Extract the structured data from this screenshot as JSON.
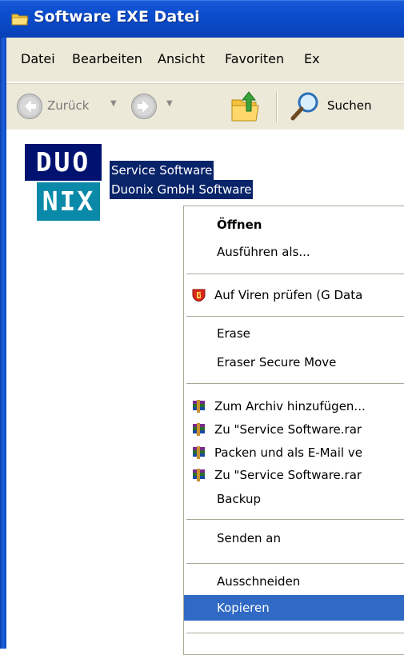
{
  "window": {
    "title": "Software EXE Datei",
    "folder_icon": "folder-icon"
  },
  "menubar": {
    "items": [
      "Datei",
      "Bearbeiten",
      "Ansicht",
      "Favoriten",
      "Ex"
    ]
  },
  "toolbar": {
    "back_label": "Zurück",
    "search_label": "Suchen"
  },
  "file": {
    "logo_top": "DUO",
    "logo_bottom": "NIX",
    "name": "Service Software",
    "company": "Duonix GmbH Software"
  },
  "context_menu": {
    "items": [
      {
        "label": "Öffnen",
        "bold": true
      },
      {
        "label": "Ausführen als..."
      },
      {
        "label": "Auf Viren prüfen (G Data"
      },
      {
        "label": "Erase"
      },
      {
        "label": "Eraser Secure Move"
      },
      {
        "label": "Zum Archiv hinzufügen..."
      },
      {
        "label": "Zu \"Service Software.rar"
      },
      {
        "label": "Packen und als E-Mail ve"
      },
      {
        "label": "Zu \"Service Software.rar"
      },
      {
        "label": "Backup"
      },
      {
        "label": "Senden an"
      },
      {
        "label": "Ausschneiden"
      },
      {
        "label": "Kopieren",
        "highlighted": true
      }
    ]
  },
  "colors": {
    "selection": "#0a246a",
    "highlight": "#316ac5",
    "titlebar": "#0a47c2",
    "chrome": "#ece9d8"
  }
}
